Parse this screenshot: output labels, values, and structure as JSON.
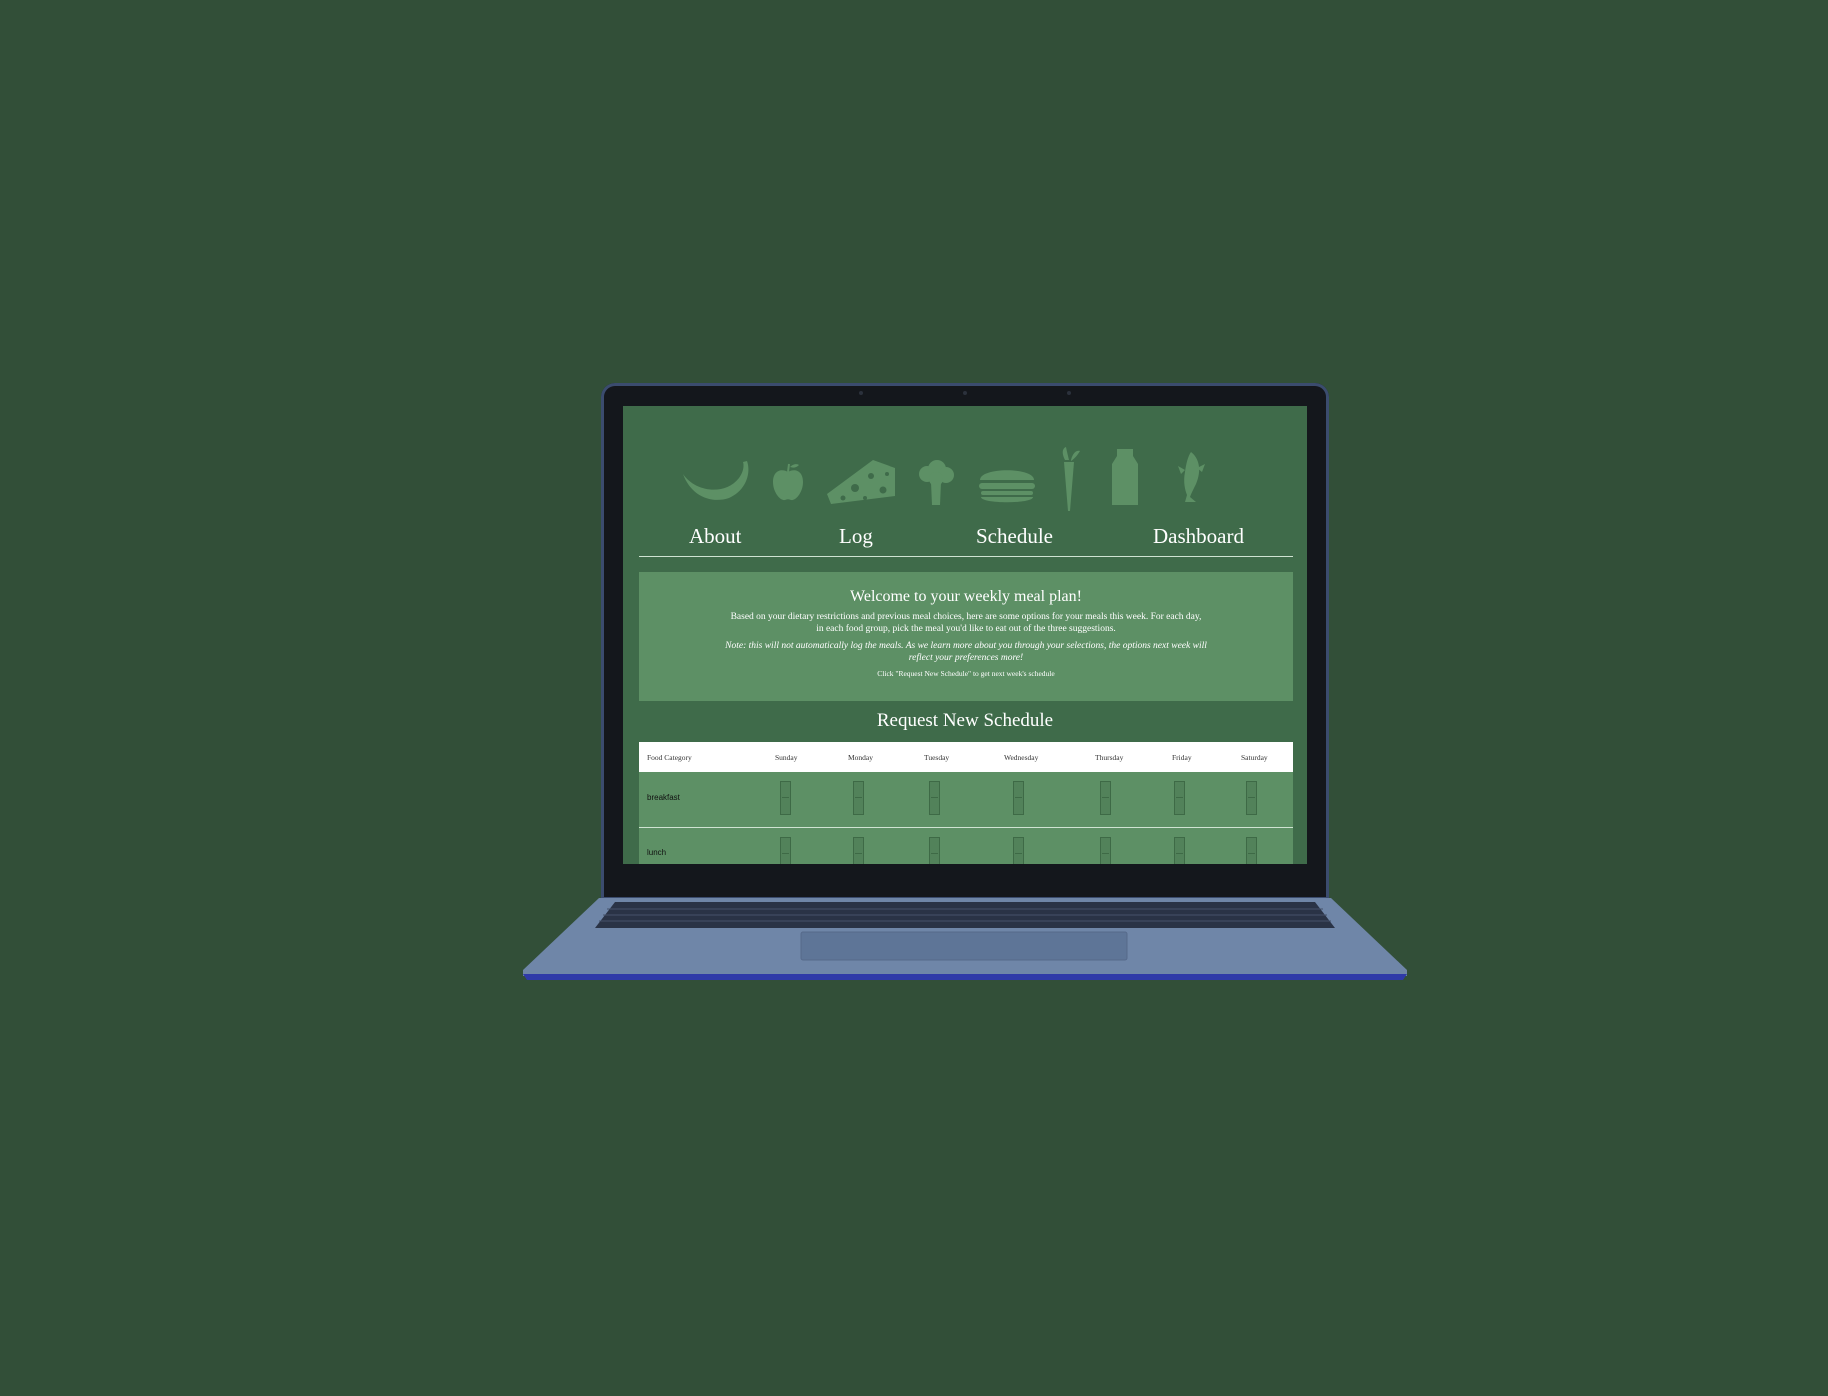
{
  "nav": {
    "items": [
      {
        "label": "About"
      },
      {
        "label": "Log"
      },
      {
        "label": "Schedule"
      },
      {
        "label": "Dashboard"
      }
    ]
  },
  "food_icons": [
    "banana-icon",
    "apple-icon",
    "cheese-icon",
    "broccoli-icon",
    "burger-icon",
    "carrot-icon",
    "milk-carton-icon",
    "fish-icon"
  ],
  "welcome": {
    "title": "Welcome to your weekly meal plan!",
    "text": "Based on your dietary restrictions and previous meal choices, here are some options for your meals this week. For each day, in each food group, pick the meal you'd like to eat out of the three suggestions.",
    "note": "Note: this will not automatically log the meals. As we learn more about you through your selections, the options next week will reflect your preferences more!",
    "hint": "Click \"Request New Schedule\" to get next week's schedule"
  },
  "request_button": "Request New Schedule",
  "table": {
    "columns": [
      "Food Category",
      "Sunday",
      "Monday",
      "Tuesday",
      "Wednesday",
      "Thursday",
      "Friday",
      "Saturday"
    ],
    "rows": [
      {
        "category": "breakfast"
      },
      {
        "category": "lunch"
      }
    ]
  },
  "colors": {
    "background": "#324f38",
    "screen": "#3f6b4a",
    "panel": "#5d9065",
    "laptop_body": "#6f86a8"
  }
}
